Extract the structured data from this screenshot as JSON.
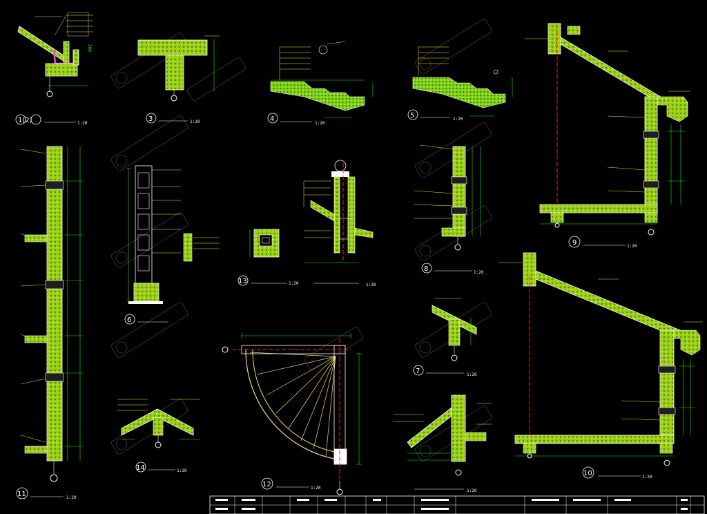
{
  "drawing": {
    "detail_labels": [
      {
        "id": "d1",
        "num": "1(2)",
        "scale": "1:20"
      },
      {
        "id": "d3",
        "num": "3",
        "scale": "1:20"
      },
      {
        "id": "d4",
        "num": "4",
        "scale": "1:20"
      },
      {
        "id": "d5",
        "num": "5",
        "scale": "1:20"
      },
      {
        "id": "d6",
        "num": "6",
        "scale": ""
      },
      {
        "id": "d13",
        "num": "13",
        "scale": "1:20"
      },
      {
        "id": "d8",
        "num": "8",
        "scale": "1:20"
      },
      {
        "id": "d9",
        "num": "9",
        "scale": "1:20"
      },
      {
        "id": "d11",
        "num": "11",
        "scale": "1:20"
      },
      {
        "id": "d14",
        "num": "14",
        "scale": "1:20"
      },
      {
        "id": "d12",
        "num": "12",
        "scale": "1:20"
      },
      {
        "id": "d7",
        "num": "7",
        "scale": "1:20"
      },
      {
        "id": "d10",
        "num": "10",
        "scale": "1:20"
      },
      {
        "id": "dss",
        "num": "",
        "scale": "1:20"
      }
    ],
    "title_block": {
      "cells": [
        "",
        "",
        "",
        "",
        "",
        "",
        "",
        "",
        "",
        ""
      ]
    }
  },
  "colors": {
    "background": "#000000",
    "concrete_hatch": "#b8e21a",
    "concrete_dot": "#2f8f10",
    "outline": "#ffffff",
    "dimension": "#00ff00",
    "leader": "#f5f500",
    "axis": "#ff2020",
    "magenta": "#ff40ff",
    "watermark": "#5a5a5a"
  },
  "watermark_text": ""
}
